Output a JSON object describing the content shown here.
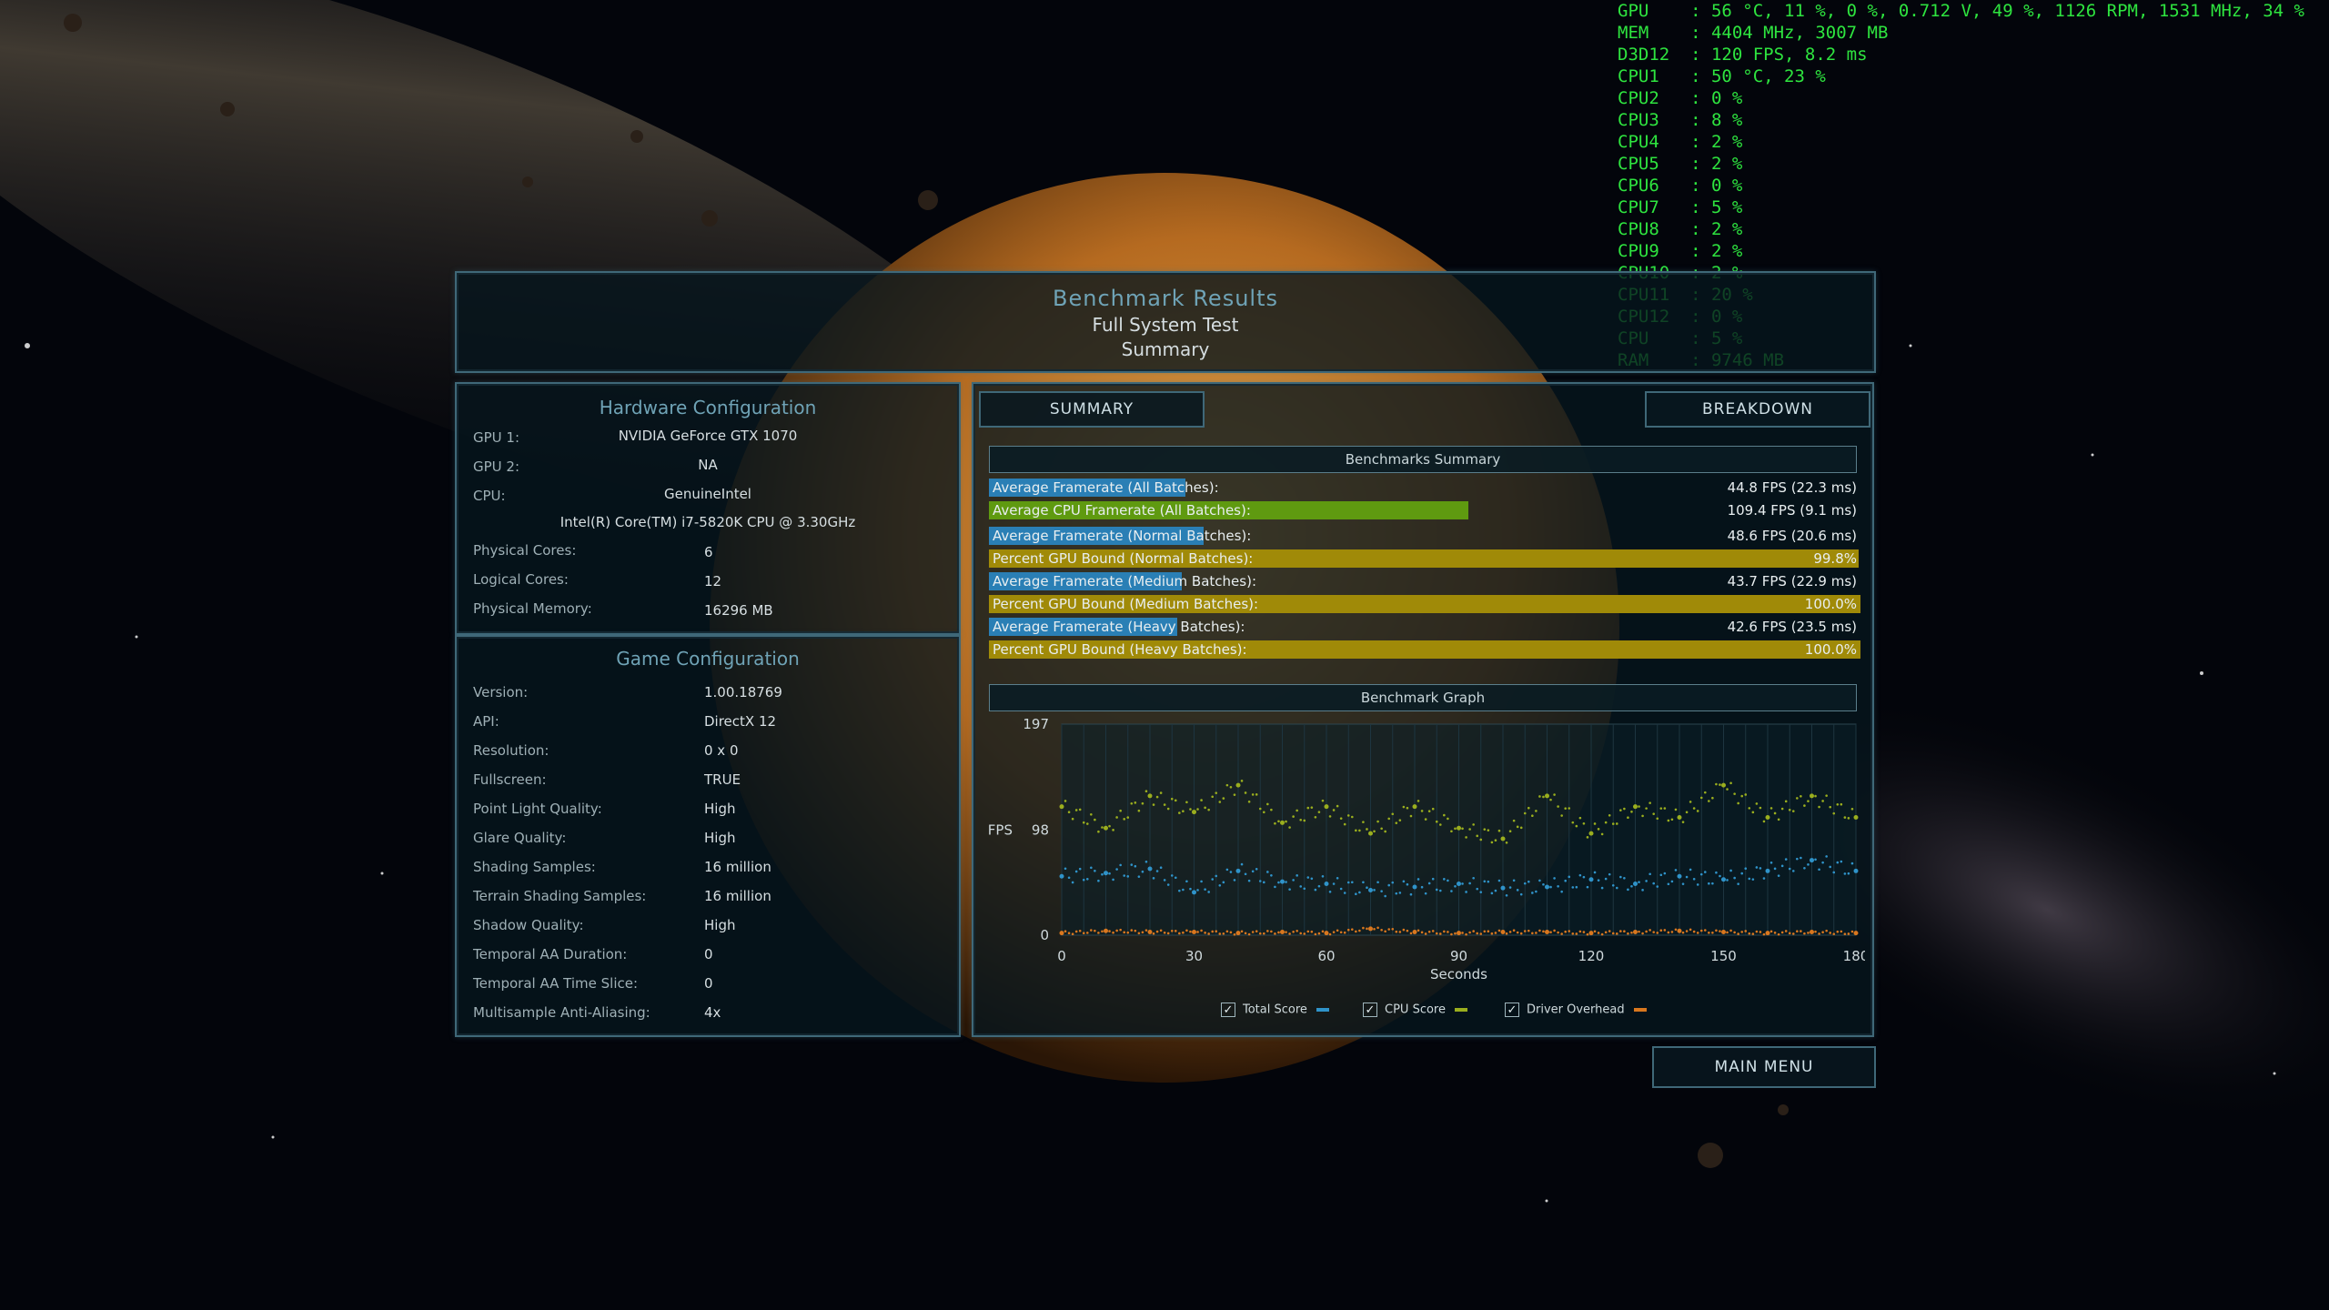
{
  "header": {
    "title": "Benchmark Results",
    "subtitle": "Full System Test",
    "page": "Summary"
  },
  "hardware": {
    "title": "Hardware Configuration",
    "gpu1_label": "GPU 1:",
    "gpu1": "NVIDIA GeForce GTX 1070",
    "gpu2_label": "GPU 2:",
    "gpu2": "NA",
    "cpu_label": "CPU:",
    "cpu_vendor": "GenuineIntel",
    "cpu_model": "Intel(R) Core(TM) i7-5820K CPU @ 3.30GHz",
    "phys_cores_label": "Physical Cores:",
    "phys_cores": "6",
    "log_cores_label": "Logical Cores:",
    "log_cores": "12",
    "mem_label": "Physical Memory:",
    "mem": "16296  MB"
  },
  "game": {
    "title": "Game Configuration",
    "rows": [
      {
        "label": "Version:",
        "value": "1.00.18769"
      },
      {
        "label": "API:",
        "value": "DirectX 12"
      },
      {
        "label": "Resolution:",
        "value": "0 x 0"
      },
      {
        "label": "Fullscreen:",
        "value": "TRUE"
      },
      {
        "label": "Point Light Quality:",
        "value": "High"
      },
      {
        "label": "Glare Quality:",
        "value": "High"
      },
      {
        "label": "Shading Samples:",
        "value": "16 million"
      },
      {
        "label": "Terrain Shading Samples:",
        "value": "16 million"
      },
      {
        "label": "Shadow Quality:",
        "value": "High"
      },
      {
        "label": "Temporal AA Duration:",
        "value": "0"
      },
      {
        "label": "Temporal AA Time Slice:",
        "value": "0"
      },
      {
        "label": "Multisample Anti-Aliasing:",
        "value": "4x"
      }
    ]
  },
  "tabs": {
    "summary": "SUMMARY",
    "breakdown": "BREAKDOWN"
  },
  "summary": {
    "title": "Benchmarks Summary",
    "rows": [
      {
        "label": "Average Framerate (All Batches):",
        "value": "44.8 FPS (22.3 ms)",
        "fill": 0.225,
        "color": "#2a7fb5"
      },
      {
        "label": "Average CPU Framerate (All Batches):",
        "value": "109.4 FPS (9.1 ms)",
        "fill": 0.55,
        "color": "#5f9a10"
      },
      {
        "label": "Average Framerate (Normal Batches):",
        "value": "48.6 FPS (20.6 ms)",
        "fill": 0.246,
        "color": "#2a7fb5"
      },
      {
        "label": "Percent GPU Bound (Normal Batches):",
        "value": "99.8%",
        "fill": 0.998,
        "color": "#a08a08"
      },
      {
        "label": "Average Framerate (Medium Batches):",
        "value": "43.7 FPS (22.9 ms)",
        "fill": 0.221,
        "color": "#2a7fb5"
      },
      {
        "label": "Percent GPU Bound (Medium Batches):",
        "value": "100.0%",
        "fill": 1.0,
        "color": "#a08a08"
      },
      {
        "label": "Average Framerate (Heavy Batches):",
        "value": "42.6 FPS (23.5 ms)",
        "fill": 0.216,
        "color": "#2a7fb5"
      },
      {
        "label": "Percent GPU Bound (Heavy Batches):",
        "value": "100.0%",
        "fill": 1.0,
        "color": "#a08a08"
      }
    ]
  },
  "chart_data": {
    "type": "scatter",
    "title": "Benchmark Graph",
    "xlabel": "Seconds",
    "ylabel": "FPS",
    "xlim": [
      0,
      180
    ],
    "ylim": [
      0,
      197
    ],
    "x_ticks": [
      "0",
      "30",
      "60",
      "90",
      "120",
      "150",
      "180"
    ],
    "y_ticks": [
      "0",
      "98",
      "197"
    ],
    "series": [
      {
        "name": "Total Score",
        "color": "#2f93c9",
        "x": [
          0,
          10,
          20,
          30,
          40,
          50,
          60,
          70,
          80,
          90,
          100,
          110,
          120,
          130,
          140,
          150,
          160,
          170,
          180
        ],
        "y": [
          55,
          58,
          62,
          40,
          60,
          50,
          48,
          42,
          45,
          48,
          44,
          45,
          52,
          48,
          55,
          52,
          60,
          70,
          60
        ]
      },
      {
        "name": "CPU Score",
        "color": "#9aae1e",
        "x": [
          0,
          10,
          20,
          30,
          40,
          50,
          60,
          70,
          80,
          90,
          100,
          110,
          120,
          130,
          140,
          150,
          160,
          170,
          180
        ],
        "y": [
          120,
          100,
          130,
          115,
          140,
          105,
          120,
          95,
          120,
          100,
          90,
          130,
          95,
          120,
          110,
          140,
          110,
          130,
          110
        ]
      },
      {
        "name": "Driver Overhead",
        "color": "#d9771e",
        "x": [
          0,
          10,
          20,
          30,
          40,
          50,
          60,
          70,
          80,
          90,
          100,
          110,
          120,
          130,
          140,
          150,
          160,
          170,
          180
        ],
        "y": [
          2,
          4,
          3,
          3,
          2,
          3,
          2,
          6,
          3,
          2,
          3,
          3,
          2,
          3,
          4,
          3,
          2,
          3,
          2
        ]
      }
    ]
  },
  "main_menu": "MAIN MENU",
  "osd": {
    "lines": [
      "GPU    : 56 °C, 11 %, 0 %, 0.712 V, 49 %, 1126 RPM, 1531 MHz, 34 %",
      "MEM    : 4404 MHz, 3007 MB",
      "D3D12  : 120 FPS, 8.2 ms",
      "CPU1   : 50 °C, 23 %",
      "CPU2   : 0 %",
      "CPU3   : 8 %",
      "CPU4   : 2 %",
      "CPU5   : 2 %",
      "CPU6   : 0 %",
      "CPU7   : 5 %",
      "CPU8   : 2 %",
      "CPU9   : 2 %",
      "CPU10  : 2 %",
      "CPU11  : 20 %",
      "CPU12  : 0 %",
      "CPU    : 5 %",
      "RAM    : 9746 MB"
    ]
  }
}
